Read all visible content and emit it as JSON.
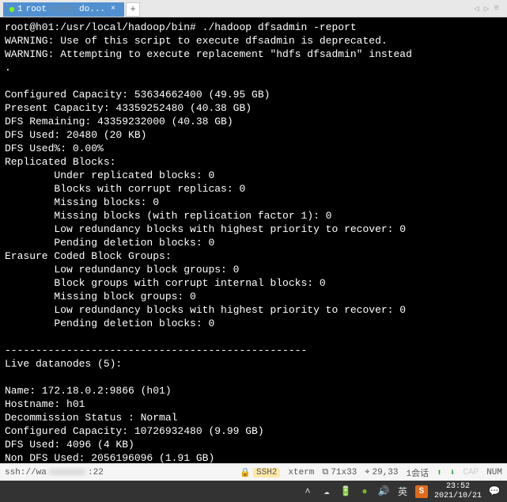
{
  "tab": {
    "index": "1",
    "label": "root",
    "suffix": "do..."
  },
  "terminal": {
    "prompt": "root@h01:/usr/local/hadoop/bin#",
    "command": "./hadoop dfsadmin -report",
    "lines": [
      "WARNING: Use of this script to execute dfsadmin is deprecated.",
      "WARNING: Attempting to execute replacement \"hdfs dfsadmin\" instead",
      ".",
      "",
      "Configured Capacity: 53634662400 (49.95 GB)",
      "Present Capacity: 43359252480 (40.38 GB)",
      "DFS Remaining: 43359232000 (40.38 GB)",
      "DFS Used: 20480 (20 KB)",
      "DFS Used%: 0.00%",
      "Replicated Blocks:",
      "        Under replicated blocks: 0",
      "        Blocks with corrupt replicas: 0",
      "        Missing blocks: 0",
      "        Missing blocks (with replication factor 1): 0",
      "        Low redundancy blocks with highest priority to recover: 0",
      "        Pending deletion blocks: 0",
      "Erasure Coded Block Groups:",
      "        Low redundancy block groups: 0",
      "        Block groups with corrupt internal blocks: 0",
      "        Missing block groups: 0",
      "        Low redundancy blocks with highest priority to recover: 0",
      "        Pending deletion blocks: 0",
      "",
      "-------------------------------------------------",
      "Live datanodes (5):",
      "",
      "Name: 172.18.0.2:9866 (h01)",
      "Hostname: h01",
      "Decommission Status : Normal",
      "Configured Capacity: 10726932480 (9.99 GB)",
      "DFS Used: 4096 (4 KB)",
      "Non DFS Used: 2056196096 (1.91 GB)"
    ]
  },
  "statusbar": {
    "conn": "ssh://wa",
    "port": ":22",
    "ssh": "SSH2",
    "term": "xterm",
    "size": "71x33",
    "cursor": "29,33",
    "session": "1会话",
    "cap": "CAP",
    "num": "NUM"
  },
  "taskbar": {
    "time": "23:52",
    "date": "2021/10/21"
  }
}
